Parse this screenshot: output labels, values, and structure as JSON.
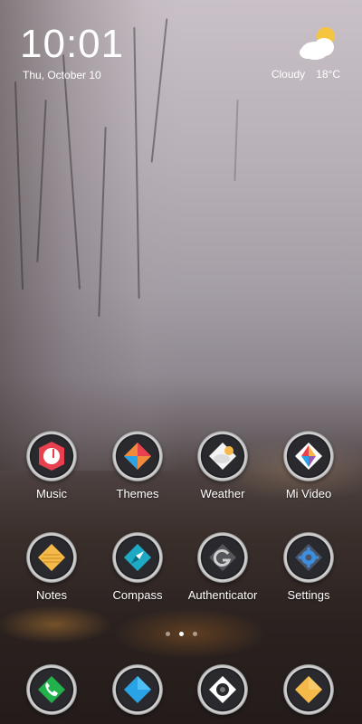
{
  "status": {
    "time": "10:01",
    "date": "Thu, October 10",
    "weather_condition": "Cloudy",
    "temperature": "18°C",
    "weather_icon": "partly-cloudy-icon"
  },
  "apps_row1": [
    {
      "label": "Music",
      "icon": "music-icon"
    },
    {
      "label": "Themes",
      "icon": "themes-icon"
    },
    {
      "label": "Weather",
      "icon": "weather-app-icon"
    },
    {
      "label": "Mi Video",
      "icon": "video-icon"
    }
  ],
  "apps_row2": [
    {
      "label": "Notes",
      "icon": "notes-icon"
    },
    {
      "label": "Compass",
      "icon": "compass-icon"
    },
    {
      "label": "Authenticator",
      "icon": "authenticator-icon"
    },
    {
      "label": "Settings",
      "icon": "settings-icon"
    }
  ],
  "dock": [
    {
      "icon": "phone-icon"
    },
    {
      "icon": "messages-icon"
    },
    {
      "icon": "camera-icon"
    },
    {
      "icon": "browser-icon"
    }
  ],
  "page_indicator": {
    "pages": 3,
    "current": 2
  },
  "colors": {
    "music": "#e8404e",
    "compass": "#1ea9c4",
    "phone": "#22b24c",
    "dock_blue": "#2aa3e6",
    "notes": "#f5b94a"
  }
}
